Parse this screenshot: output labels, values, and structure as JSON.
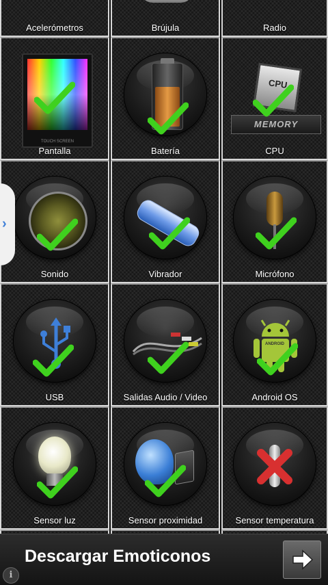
{
  "tiles": [
    {
      "id": "acelerometros",
      "label": "Acelerómetros"
    },
    {
      "id": "brujula",
      "label": "Brújula"
    },
    {
      "id": "radio",
      "label": "Radio"
    },
    {
      "id": "pantalla",
      "label": "Pantalla",
      "screen_caption": "TOUCH SCREEN"
    },
    {
      "id": "bateria",
      "label": "Batería"
    },
    {
      "id": "cpu",
      "label": "CPU",
      "chip_text": "CPU",
      "memory_text": "MEMORY"
    },
    {
      "id": "sonido",
      "label": "Sonido"
    },
    {
      "id": "vibrador",
      "label": "Vibrador"
    },
    {
      "id": "microfono",
      "label": "Micrófono"
    },
    {
      "id": "usb",
      "label": "USB"
    },
    {
      "id": "salidas",
      "label": "Salidas Audio / Video"
    },
    {
      "id": "android",
      "label": "Android OS",
      "badge_text": "ANDROID"
    },
    {
      "id": "sensor_luz",
      "label": "Sensor luz"
    },
    {
      "id": "sensor_proximidad",
      "label": "Sensor proximidad"
    },
    {
      "id": "sensor_temperatura",
      "label": "Sensor temperatura"
    }
  ],
  "ad": {
    "text": "Descargar Emoticonos",
    "info_glyph": "i"
  },
  "edge_tab": {
    "glyph": "›"
  },
  "colors": {
    "check": "#3fd11e",
    "tile_border": "#d9d9d9",
    "blue_accent": "#3e7fd8"
  }
}
